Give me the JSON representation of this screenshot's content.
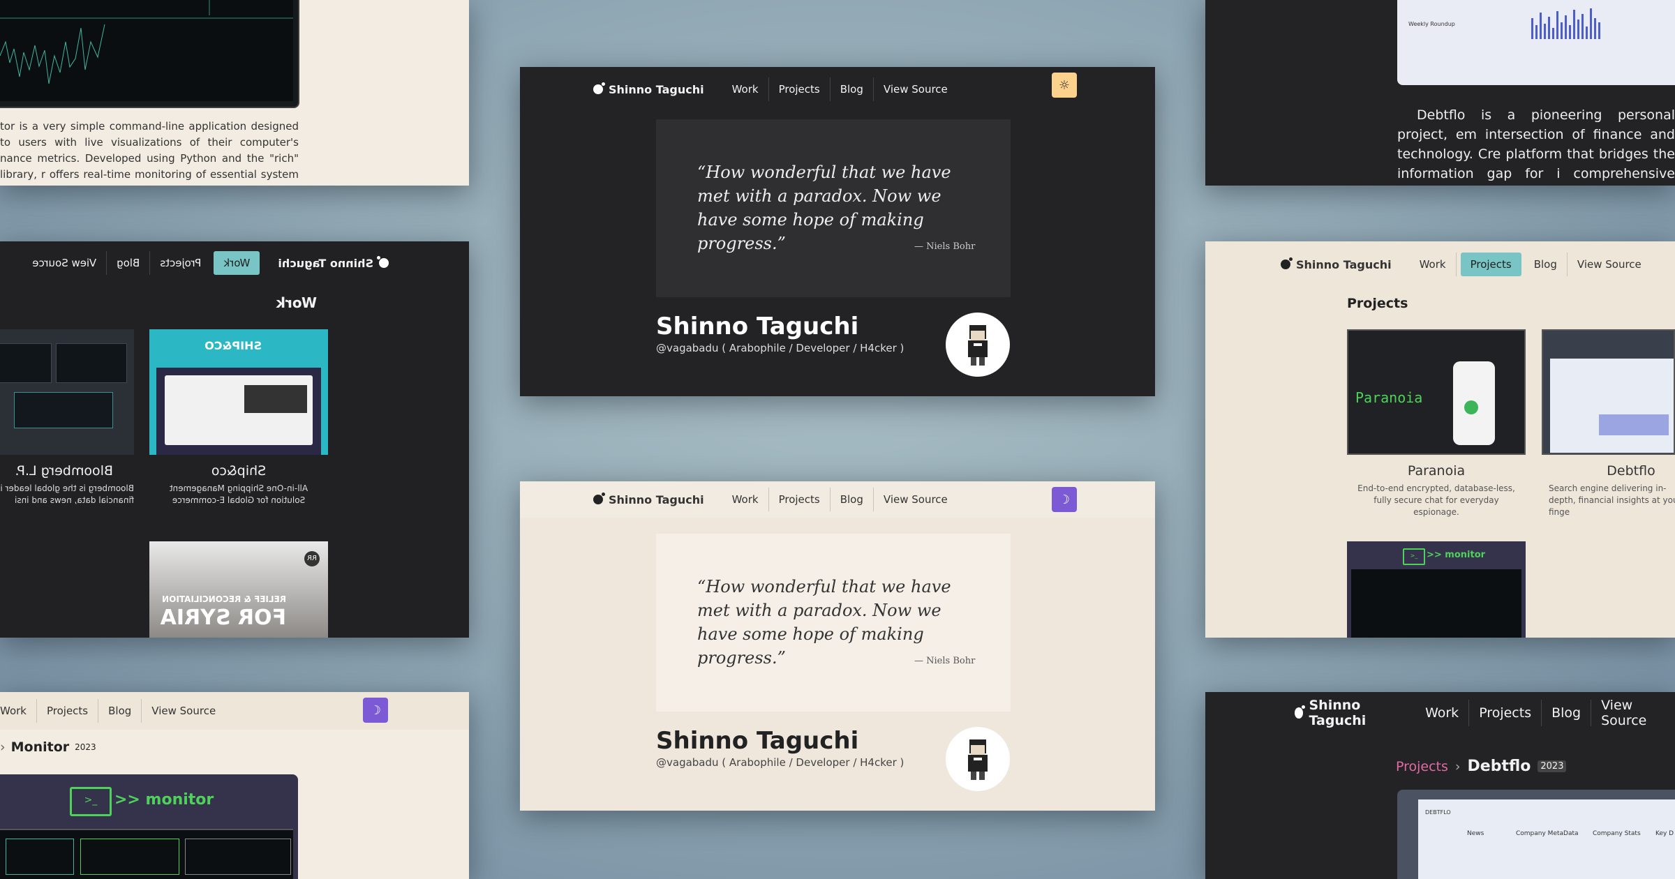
{
  "site": {
    "brand": "Shinno Taguchi",
    "nav": [
      "Work",
      "Projects",
      "Blog",
      "View Source"
    ]
  },
  "hero": {
    "quote": "“How wonderful that we have met with a paradox. Now we have some hope of making progress.”",
    "attribution": "— Niels Bohr",
    "name": "Shinno Taguchi",
    "handle": "@vagabadu ( Arabophile / Developer / H4cker )"
  },
  "monitor_page": {
    "description": "tor is a very simple command-line application designed to users with live visualizations of their computer's nance metrics. Developed using Python and the \"rich\" library, r offers real-time monitoring of essential system statistics,",
    "breadcrumb_sep": "›",
    "title": "Monitor",
    "year": "2023",
    "banner": ">> monitor"
  },
  "work_page": {
    "heading": "Work",
    "items": [
      {
        "title": "Bloomberg L.P.",
        "desc": "Bloomberg is the global leader in financial data, news and insi"
      },
      {
        "title": "Ship&co",
        "desc": "All-in-One Shipping Management Solution for Global E-commerce"
      }
    ],
    "syria": {
      "line1": "RELIEF & RECONCILIATION",
      "line2": "FOR SYRIA",
      "logo": "RR"
    }
  },
  "debtflo_page": {
    "description": "Debtflo is a pioneering personal project, em intersection of finance and technology. Cre platform that bridges the information gap for i comprehensive financial information, elegant",
    "breadcrumb": "Projects",
    "title": "Debtflo",
    "year": "2023",
    "tabs": [
      "News",
      "Company MetaData",
      "Company Stats",
      "Key D"
    ],
    "weekly": "Weekly Roundup"
  },
  "projects_page": {
    "heading": "Projects",
    "items": [
      {
        "title": "Paranoia",
        "desc": "End-to-end encrypted, database-less, fully secure chat for everyday espionage.",
        "logo": "Paranoia"
      },
      {
        "title": "Debtflo",
        "desc": "Search engine delivering in-depth, financial insights at your finge"
      }
    ],
    "monitor_banner": ">> monitor"
  },
  "colors": {
    "dark_bg": "#232325",
    "light_bg": "#efe7dc",
    "sun_toggle": "#fdd28c",
    "moon_toggle": "#7c5ad6",
    "active_tab": "#79c4c4",
    "breadcrumb_link": "#e26aa4",
    "monitor_green": "#4fd25a"
  }
}
